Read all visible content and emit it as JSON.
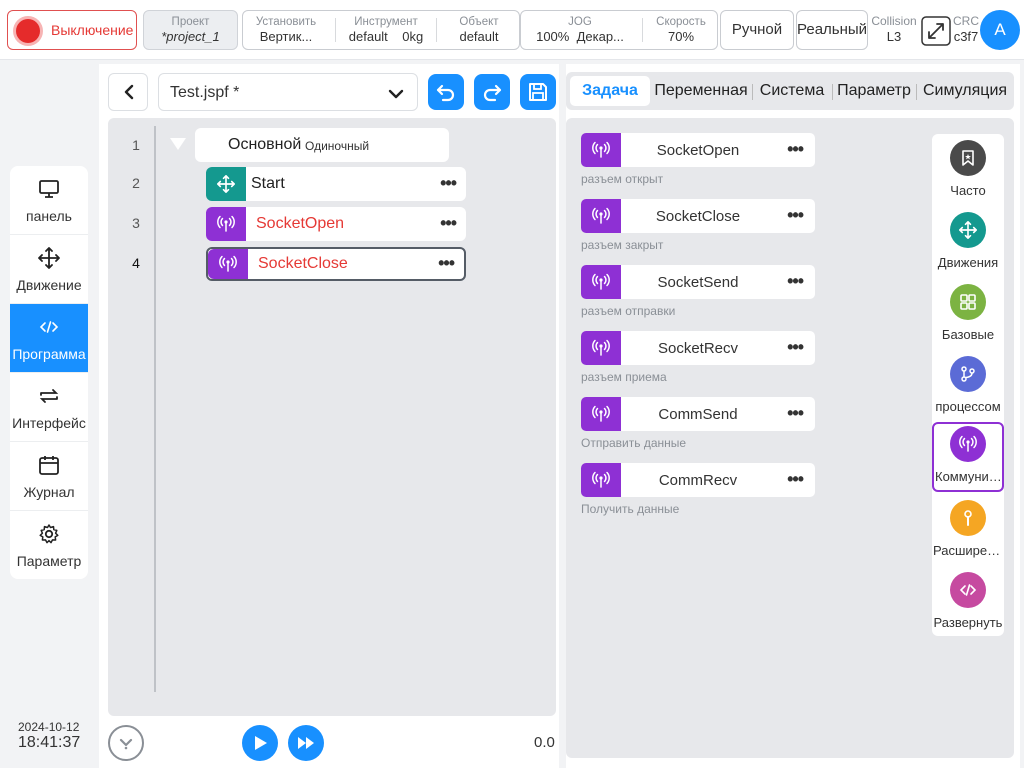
{
  "topbar": {
    "power_label": "Выключение",
    "project": {
      "label": "Проект",
      "value": "*project_1"
    },
    "install": {
      "label": "Установить",
      "value": "Вертик..."
    },
    "tool": {
      "label": "Инструмент",
      "value": "default",
      "value2": "0kg"
    },
    "object": {
      "label": "Объект",
      "value": "default"
    },
    "jog": {
      "label": "JOG",
      "value": "100%",
      "value2": "Декар..."
    },
    "speed": {
      "label": "Скорость",
      "value": "70%"
    },
    "mode_label": "Ручной",
    "real_label": "Реальный",
    "collision": {
      "label": "Collision",
      "value": "L3"
    },
    "crc": {
      "label": "CRC",
      "value": "c3f7"
    },
    "avatar": "A"
  },
  "sidebar": {
    "items": [
      {
        "label": "панель",
        "icon": "monitor-icon"
      },
      {
        "label": "Движение",
        "icon": "move-icon"
      },
      {
        "label": "Программа",
        "icon": "code-icon"
      },
      {
        "label": "Интерфейс",
        "icon": "swap-icon"
      },
      {
        "label": "Журнал",
        "icon": "calendar-icon"
      },
      {
        "label": "Параметр",
        "icon": "gear-icon"
      }
    ],
    "active_index": 2
  },
  "clock": {
    "date": "2024-10-12",
    "time": "18:41:37"
  },
  "editor": {
    "file_name": "Test.jspf *",
    "tree": [
      {
        "line": "1",
        "label": "Основной",
        "sub": "Одиночный"
      },
      {
        "line": "2",
        "label": "Start"
      },
      {
        "line": "3",
        "label": "SocketOpen"
      },
      {
        "line": "4",
        "label": "SocketClose"
      }
    ],
    "more_glyph": "•••",
    "progress_value": "0.0"
  },
  "tabs": [
    "Задача",
    "Переменная",
    "Система",
    "Параметр",
    "Симуляция"
  ],
  "blocks": [
    {
      "name": "SocketOpen",
      "desc": "разъем открыт"
    },
    {
      "name": "SocketClose",
      "desc": "разъем закрыт"
    },
    {
      "name": "SocketSend",
      "desc": "разъем отправки"
    },
    {
      "name": "SocketRecv",
      "desc": "разъем приема"
    },
    {
      "name": "CommSend",
      "desc": "Отправить данные"
    },
    {
      "name": "CommRecv",
      "desc": "Получить данные"
    }
  ],
  "categories": [
    {
      "label": "Часто",
      "color": "#4a4a4a"
    },
    {
      "label": "Движения",
      "color": "#14998f"
    },
    {
      "label": "Базовые",
      "color": "#7cb342"
    },
    {
      "label": "процессом",
      "color": "#5b6bd6"
    },
    {
      "label": "Коммуникация",
      "color": "#8e30d4"
    },
    {
      "label": "Расширение",
      "color": "#f5a623"
    },
    {
      "label": "Развернуть",
      "color": "#c64aa0"
    }
  ],
  "colors": {
    "accent": "#1890ff",
    "comm_purple": "#8e30d4",
    "move_teal": "#14998f",
    "error_red": "#e53935"
  }
}
